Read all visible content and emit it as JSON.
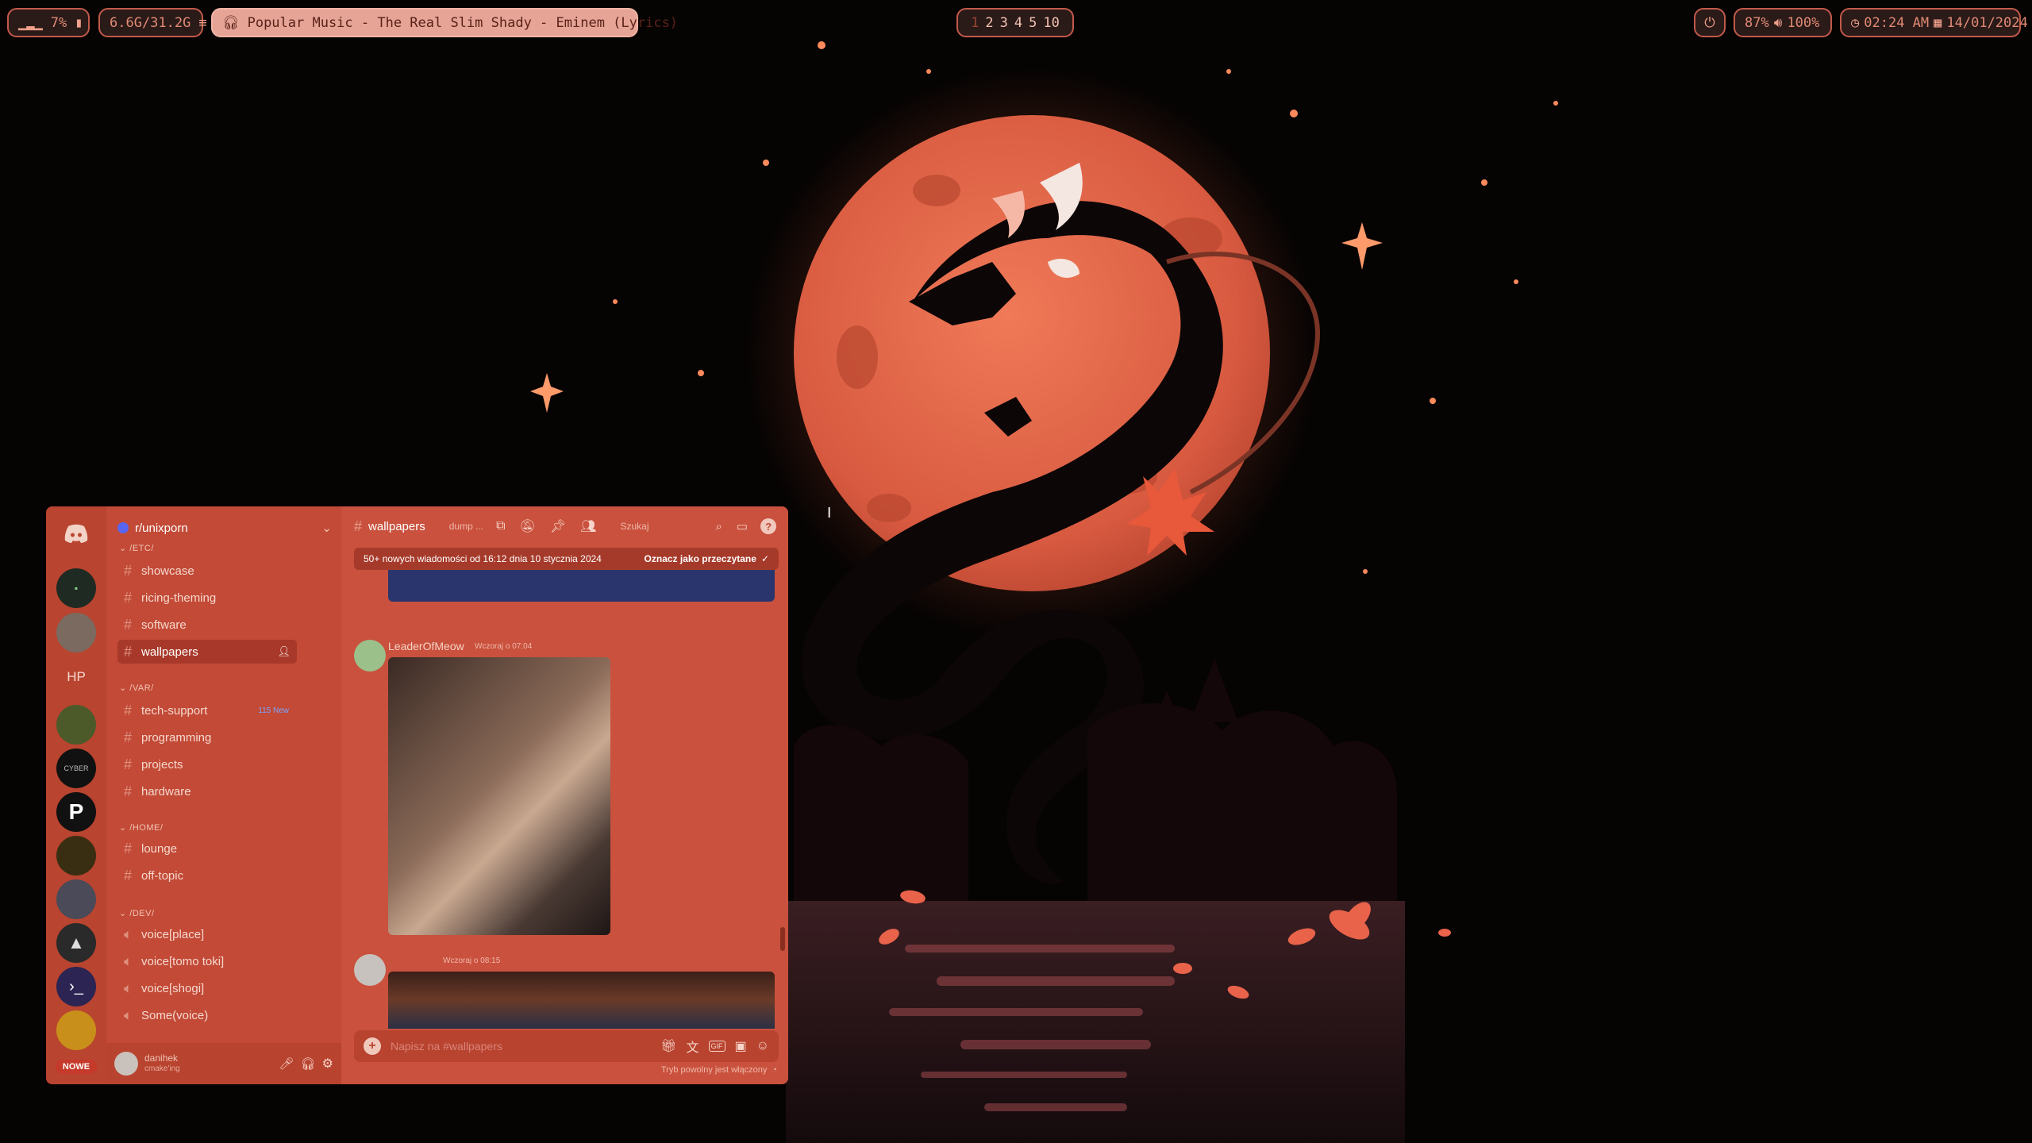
{
  "topbar": {
    "cpu": "7%",
    "memory": "6.6G/31.2G",
    "music": "Popular Music - The Real Slim Shady  - Eminem (Lyrics)",
    "workspaces": [
      "1",
      "2",
      "3",
      "4",
      "5",
      "10"
    ],
    "active_workspace": "1",
    "battery_and_brightness": "87%",
    "volume": "100%",
    "time": "02:24 AM",
    "date": "14/01/2024"
  },
  "discord": {
    "server_name": "r/unixporn",
    "channel_title": "wallpapers",
    "channel_topic": "dump ...",
    "search_placeholder": "Szukaj",
    "new_messages_banner": "50+ nowych wiadomości od 16:12 dnia 10 stycznia 2024",
    "mark_read": "Oznacz jako przeczytane",
    "rail_label": "HP",
    "new_badge": "NOWE",
    "categories": [
      {
        "label": "/ETC/",
        "channels": [
          "showcase",
          "ricing-theming",
          "software",
          "wallpapers"
        ]
      },
      {
        "label": "/VAR/",
        "channels": [
          "tech-support",
          "programming",
          "projects",
          "hardware"
        ]
      },
      {
        "label": "/HOME/",
        "channels": [
          "lounge",
          "off-topic"
        ]
      },
      {
        "label": "/DEV/",
        "channels": [
          "voice[place]",
          "voice[tomo toki]",
          "voice[shogi]",
          "Some(voice)"
        ]
      }
    ],
    "unread_badge": "115 New",
    "messages": [
      {
        "author": "LeaderOfMeow",
        "time": "Wczoraj o 07:04"
      },
      {
        "author": "",
        "time": "Wczoraj o 08:15"
      }
    ],
    "composer_placeholder": "Napisz na #wallpapers",
    "slowmode": "Tryb powolny jest włączony",
    "user": {
      "name": "danihek",
      "status": "cmake'ing"
    }
  },
  "colors": {
    "accent": "#c9503c",
    "pill_border": "#c25a4a",
    "moon": "#d9654a"
  }
}
